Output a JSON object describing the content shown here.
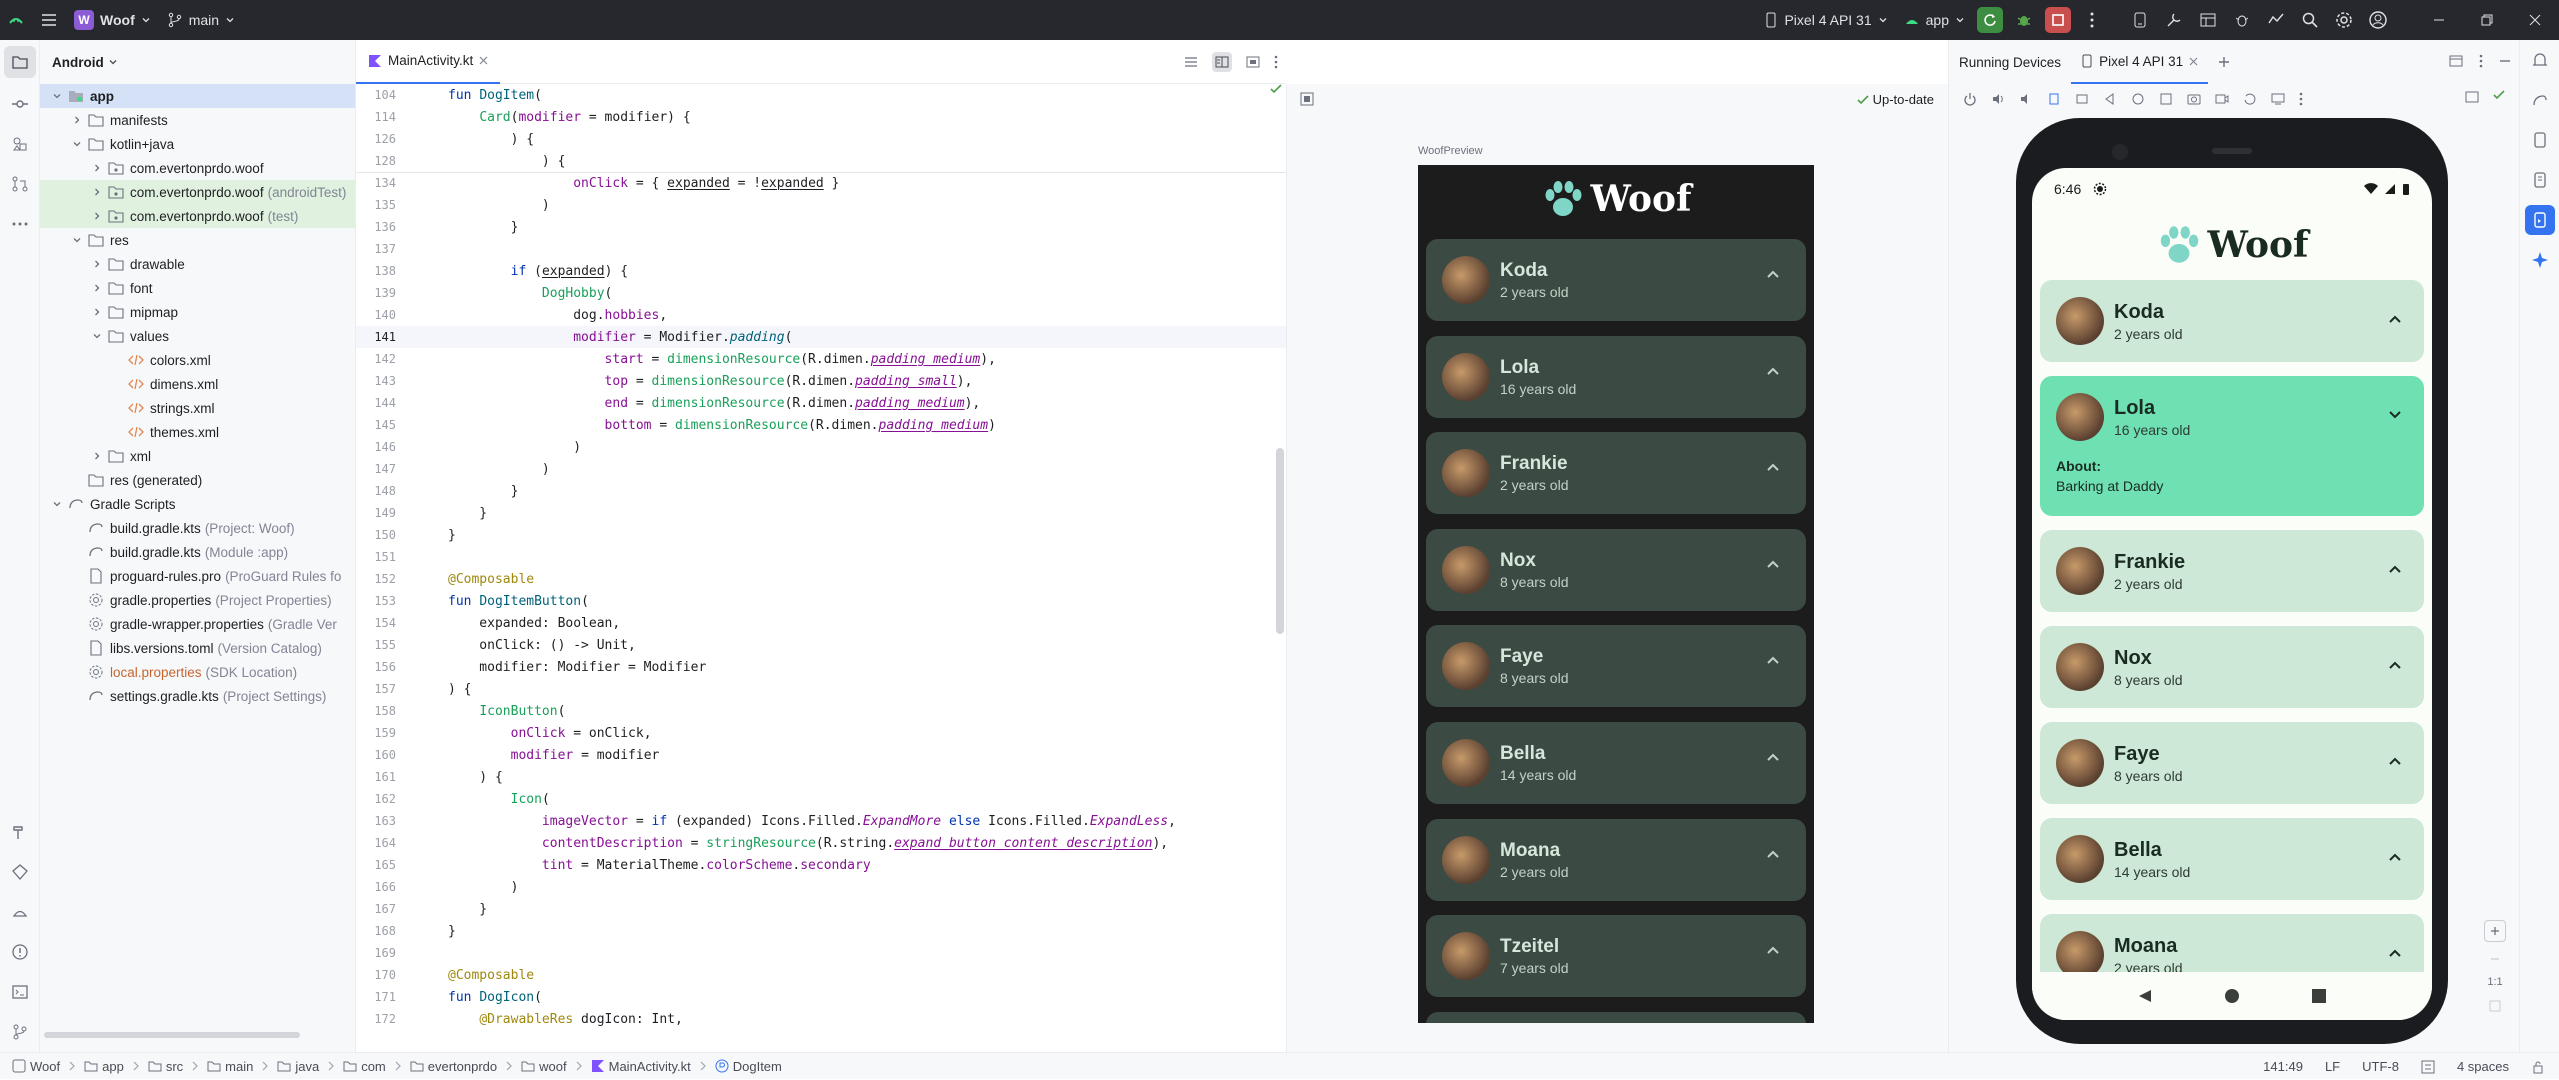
{
  "titlebar": {
    "project_badge": "W",
    "project_name": "Woof",
    "branch": "main",
    "device": "Pixel 4 API 31",
    "run_config": "app"
  },
  "project_panel": {
    "view_mode": "Android",
    "tree": [
      {
        "label": "app",
        "hint": "",
        "depth": 0,
        "expanded": true,
        "icon": "module-folder-icon",
        "state": "selected"
      },
      {
        "label": "manifests",
        "hint": "",
        "depth": 1,
        "expanded": false,
        "icon": "folder-icon",
        "state": ""
      },
      {
        "label": "kotlin+java",
        "hint": "",
        "depth": 1,
        "expanded": true,
        "icon": "folder-icon",
        "state": ""
      },
      {
        "label": "com.evertonprdo.woof",
        "hint": "",
        "depth": 2,
        "expanded": false,
        "icon": "package-icon",
        "state": ""
      },
      {
        "label": "com.evertonprdo.woof",
        "hint": "(androidTest)",
        "depth": 2,
        "expanded": false,
        "icon": "package-icon",
        "state": "green"
      },
      {
        "label": "com.evertonprdo.woof",
        "hint": "(test)",
        "depth": 2,
        "expanded": false,
        "icon": "package-icon",
        "state": "green"
      },
      {
        "label": "res",
        "hint": "",
        "depth": 1,
        "expanded": true,
        "icon": "folder-icon",
        "state": ""
      },
      {
        "label": "drawable",
        "hint": "",
        "depth": 2,
        "expanded": false,
        "icon": "folder-icon",
        "state": ""
      },
      {
        "label": "font",
        "hint": "",
        "depth": 2,
        "expanded": false,
        "icon": "folder-icon",
        "state": ""
      },
      {
        "label": "mipmap",
        "hint": "",
        "depth": 2,
        "expanded": false,
        "icon": "folder-icon",
        "state": ""
      },
      {
        "label": "values",
        "hint": "",
        "depth": 2,
        "expanded": true,
        "icon": "folder-icon",
        "state": ""
      },
      {
        "label": "colors.xml",
        "hint": "",
        "depth": 3,
        "expanded": null,
        "icon": "xml-file-icon",
        "state": ""
      },
      {
        "label": "dimens.xml",
        "hint": "",
        "depth": 3,
        "expanded": null,
        "icon": "xml-file-icon",
        "state": ""
      },
      {
        "label": "strings.xml",
        "hint": "",
        "depth": 3,
        "expanded": null,
        "icon": "xml-file-icon",
        "state": ""
      },
      {
        "label": "themes.xml",
        "hint": "",
        "depth": 3,
        "expanded": null,
        "icon": "xml-file-icon",
        "state": ""
      },
      {
        "label": "xml",
        "hint": "",
        "depth": 2,
        "expanded": false,
        "icon": "folder-icon",
        "state": ""
      },
      {
        "label": "res (generated)",
        "hint": "",
        "depth": 1,
        "expanded": null,
        "icon": "folder-icon",
        "state": ""
      },
      {
        "label": "Gradle Scripts",
        "hint": "",
        "depth": 0,
        "expanded": true,
        "icon": "gradle-icon",
        "state": ""
      },
      {
        "label": "build.gradle.kts",
        "hint": "(Project: Woof)",
        "depth": 1,
        "expanded": null,
        "icon": "gradle-file-icon",
        "state": ""
      },
      {
        "label": "build.gradle.kts",
        "hint": "(Module :app)",
        "depth": 1,
        "expanded": null,
        "icon": "gradle-file-icon",
        "state": ""
      },
      {
        "label": "proguard-rules.pro",
        "hint": "(ProGuard Rules fo",
        "depth": 1,
        "expanded": null,
        "icon": "file-icon",
        "state": ""
      },
      {
        "label": "gradle.properties",
        "hint": "(Project Properties)",
        "depth": 1,
        "expanded": null,
        "icon": "settings-file-icon",
        "state": ""
      },
      {
        "label": "gradle-wrapper.properties",
        "hint": "(Gradle Ver",
        "depth": 1,
        "expanded": null,
        "icon": "settings-file-icon",
        "state": ""
      },
      {
        "label": "libs.versions.toml",
        "hint": "(Version Catalog)",
        "depth": 1,
        "expanded": null,
        "icon": "file-icon",
        "state": ""
      },
      {
        "label": "local.properties",
        "hint": "(SDK Location)",
        "depth": 1,
        "expanded": null,
        "icon": "settings-file-icon",
        "state": "orange"
      },
      {
        "label": "settings.gradle.kts",
        "hint": "(Project Settings)",
        "depth": 1,
        "expanded": null,
        "icon": "gradle-file-icon",
        "state": ""
      }
    ]
  },
  "editor": {
    "tab": "MainActivity.kt",
    "lines": [
      {
        "n": "104",
        "html": "<span class='kw'>fun</span> <span class='fn'>DogItem</span>("
      },
      {
        "n": "114",
        "html": "    <span class='ns'>Card</span>(<span class='pr'>modifier</span> = modifier) {"
      },
      {
        "n": "126",
        "html": "        ) {"
      },
      {
        "n": "128",
        "html": "            ) {"
      },
      {
        "n": "134",
        "html": "                <span class='pr'>onClick</span> = { <span class='ul'>expanded</span> = !<span class='ul'>expanded</span> }"
      },
      {
        "n": "135",
        "html": "            )"
      },
      {
        "n": "136",
        "html": "        }"
      },
      {
        "n": "137",
        "html": ""
      },
      {
        "n": "138",
        "html": "        <span class='kw'>if</span> (<span class='ul'>expanded</span>) {"
      },
      {
        "n": "139",
        "html": "            <span class='ns'>DogHobby</span>("
      },
      {
        "n": "140",
        "html": "                dog.<span class='pr'>hobbies</span>,"
      },
      {
        "n": "141",
        "html": "                <span class='pr'>modifier</span> = Modifier.<span class='fn it'>padding</span>(",
        "current": true
      },
      {
        "n": "142",
        "html": "                    <span class='pr'>start</span> = <span class='ns'>dimensionResource</span>(R.dimen.<span class='pr it ul'>padding_medium</span>),"
      },
      {
        "n": "143",
        "html": "                    <span class='pr'>top</span> = <span class='ns'>dimensionResource</span>(R.dimen.<span class='pr it ul'>padding_small</span>),"
      },
      {
        "n": "144",
        "html": "                    <span class='pr'>end</span> = <span class='ns'>dimensionResource</span>(R.dimen.<span class='pr it ul'>padding_medium</span>),"
      },
      {
        "n": "145",
        "html": "                    <span class='pr'>bottom</span> = <span class='ns'>dimensionResource</span>(R.dimen.<span class='pr it ul'>padding_medium</span>)"
      },
      {
        "n": "146",
        "html": "                )"
      },
      {
        "n": "147",
        "html": "            )"
      },
      {
        "n": "148",
        "html": "        }"
      },
      {
        "n": "149",
        "html": "    }"
      },
      {
        "n": "150",
        "html": "}"
      },
      {
        "n": "151",
        "html": ""
      },
      {
        "n": "152",
        "html": "<span class='an'>@Composable</span>"
      },
      {
        "n": "153",
        "html": "<span class='kw'>fun</span> <span class='fn'>DogItemButton</span>("
      },
      {
        "n": "154",
        "html": "    expanded: Boolean,"
      },
      {
        "n": "155",
        "html": "    onClick: () -> Unit,"
      },
      {
        "n": "156",
        "html": "    modifier: Modifier = Modifier"
      },
      {
        "n": "157",
        "html": ") {"
      },
      {
        "n": "158",
        "html": "    <span class='ns'>IconButton</span>("
      },
      {
        "n": "159",
        "html": "        <span class='pr'>onClick</span> = onClick,"
      },
      {
        "n": "160",
        "html": "        <span class='pr'>modifier</span> = modifier"
      },
      {
        "n": "161",
        "html": "    ) {"
      },
      {
        "n": "162",
        "html": "        <span class='ns'>Icon</span>("
      },
      {
        "n": "163",
        "html": "            <span class='pr'>imageVector</span> = <span class='kw'>if</span> (expanded) Icons.Filled.<span class='pr it'>ExpandMore</span> <span class='kw'>else</span> Icons.Filled.<span class='pr it'>ExpandLess</span>,"
      },
      {
        "n": "164",
        "html": "            <span class='pr'>contentDescription</span> = <span class='ns'>stringResource</span>(R.string.<span class='pr it ul'>expand_button_content_description</span>),"
      },
      {
        "n": "165",
        "html": "            <span class='pr'>tint</span> = MaterialTheme.<span class='pr'>colorScheme</span>.<span class='pr'>secondary</span>"
      },
      {
        "n": "166",
        "html": "        )"
      },
      {
        "n": "167",
        "html": "    }"
      },
      {
        "n": "168",
        "html": "}"
      },
      {
        "n": "169",
        "html": ""
      },
      {
        "n": "170",
        "html": "<span class='an'>@Composable</span>"
      },
      {
        "n": "171",
        "html": "<span class='kw'>fun</span> <span class='fn'>DogIcon</span>("
      },
      {
        "n": "172",
        "html": "    <span class='an'>@DrawableRes</span> dogIcon: Int,"
      }
    ]
  },
  "preview": {
    "status": "Up-to-date",
    "label": "WoofPreview",
    "app_title": "Woof",
    "dogs": [
      {
        "name": "Koda",
        "age": "2 years old"
      },
      {
        "name": "Lola",
        "age": "16 years old"
      },
      {
        "name": "Frankie",
        "age": "2 years old"
      },
      {
        "name": "Nox",
        "age": "8 years old"
      },
      {
        "name": "Faye",
        "age": "8 years old"
      },
      {
        "name": "Bella",
        "age": "14 years old"
      },
      {
        "name": "Moana",
        "age": "2 years old"
      },
      {
        "name": "Tzeitel",
        "age": "7 years old"
      }
    ]
  },
  "devices": {
    "panel_title": "Running Devices",
    "device_tab": "Pixel 4 API 31",
    "zoom_label": "1:1",
    "phone": {
      "time": "6:46",
      "app_title": "Woof",
      "expanded_about_label": "About:",
      "expanded_about_text": "Barking at Daddy",
      "dogs": [
        {
          "name": "Koda",
          "age": "2 years old"
        },
        {
          "name": "Lola",
          "age": "16 years old"
        },
        {
          "name": "Frankie",
          "age": "2 years old"
        },
        {
          "name": "Nox",
          "age": "8 years old"
        },
        {
          "name": "Faye",
          "age": "8 years old"
        },
        {
          "name": "Bella",
          "age": "14 years old"
        },
        {
          "name": "Moana",
          "age": "2 years old"
        }
      ]
    }
  },
  "statusbar": {
    "breadcrumbs": [
      "Woof",
      "app",
      "src",
      "main",
      "java",
      "com",
      "evertonprdo",
      "woof",
      "MainActivity.kt",
      "DogItem"
    ],
    "position": "141:49",
    "line_sep": "LF",
    "encoding": "UTF-8",
    "indent": "4 spaces"
  },
  "colors": {
    "accent": "#3574f0",
    "preview_card": "#3b4a43",
    "phone_card": "#cde8d6",
    "phone_card_expanded": "#6ee0b2",
    "run_green": "#3e8e41",
    "stop_red": "#c94f4f"
  }
}
